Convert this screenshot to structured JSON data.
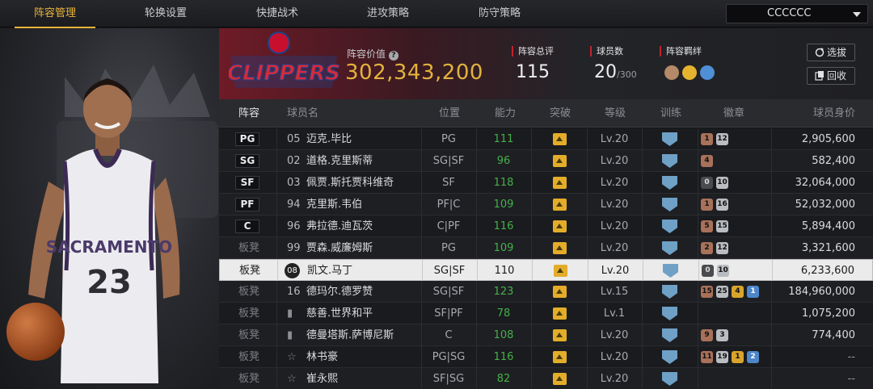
{
  "nav": {
    "tabs": [
      "阵容管理",
      "轮换设置",
      "快捷战术",
      "进攻策略",
      "防守策略"
    ],
    "team_select": "CCCCCC"
  },
  "header": {
    "team_logo_text": "CLIPPERS",
    "lineup_value_label": "阵容价值",
    "lineup_value": "302,343,200",
    "rating_label": "阵容总评",
    "rating_value": "115",
    "count_label": "球员数",
    "count_value": "20",
    "count_max": "/300",
    "chem_label": "阵容羁绊",
    "btn_draft": "选拔",
    "btn_recycle": "回收"
  },
  "table": {
    "headers": [
      "阵容",
      "球员名",
      "位置",
      "能力",
      "突破",
      "等级",
      "训练",
      "徽章",
      "球员身价"
    ],
    "rows": [
      {
        "slot": "PG",
        "starter": true,
        "num": "05",
        "name": "迈克.毕比",
        "pos": "PG",
        "ovr": "111",
        "level": "Lv.20",
        "badges": [
          [
            "b-br",
            "1"
          ],
          [
            "b-sv",
            "12"
          ]
        ],
        "value": "2,905,600"
      },
      {
        "slot": "SG",
        "starter": true,
        "num": "02",
        "name": "道格.克里斯蒂",
        "pos": "SG|SF",
        "ovr": "96",
        "level": "Lv.20",
        "badges": [
          [
            "b-br",
            "4"
          ]
        ],
        "value": "582,400"
      },
      {
        "slot": "SF",
        "starter": true,
        "num": "03",
        "name": "佩贾.斯托贾科维奇",
        "pos": "SF",
        "ovr": "118",
        "level": "Lv.20",
        "badges": [
          [
            "b-dk",
            "0"
          ],
          [
            "b-sv",
            "10"
          ]
        ],
        "value": "32,064,000"
      },
      {
        "slot": "PF",
        "starter": true,
        "num": "94",
        "name": "克里斯.韦伯",
        "pos": "PF|C",
        "ovr": "109",
        "level": "Lv.20",
        "badges": [
          [
            "b-br",
            "1"
          ],
          [
            "b-sv",
            "16"
          ]
        ],
        "value": "52,032,000"
      },
      {
        "slot": "C",
        "starter": true,
        "num": "96",
        "name": "弗拉德.迪瓦茨",
        "pos": "C|PF",
        "ovr": "116",
        "level": "Lv.20",
        "badges": [
          [
            "b-br",
            "5"
          ],
          [
            "b-sv",
            "15"
          ]
        ],
        "value": "5,894,400"
      },
      {
        "slot": "板凳",
        "starter": false,
        "num": "99",
        "name": "贾森.威廉姆斯",
        "pos": "PG",
        "ovr": "109",
        "level": "Lv.20",
        "badges": [
          [
            "b-br",
            "2"
          ],
          [
            "b-sv",
            "12"
          ]
        ],
        "value": "3,321,600"
      },
      {
        "slot": "板凳",
        "starter": false,
        "num": "08",
        "name": "凯文.马丁",
        "pos": "SG|SF",
        "ovr": "110",
        "level": "Lv.20",
        "badges": [
          [
            "b-dk",
            "0"
          ],
          [
            "b-sv",
            "10"
          ]
        ],
        "value": "6,233,600",
        "selected": true
      },
      {
        "slot": "板凳",
        "starter": false,
        "num": "16",
        "name": "德玛尔.德罗赞",
        "pos": "SG|SF",
        "ovr": "123",
        "level": "Lv.15",
        "badges": [
          [
            "b-br",
            "15"
          ],
          [
            "b-sv",
            "25"
          ],
          [
            "b-gd",
            "4"
          ],
          [
            "b-bl",
            "1"
          ]
        ],
        "value": "184,960,000"
      },
      {
        "slot": "板凳",
        "starter": false,
        "num": "",
        "name": "慈善.世界和平",
        "pos": "SF|PF",
        "ovr": "78",
        "level": "Lv.1",
        "badges": [],
        "value": "1,075,200"
      },
      {
        "slot": "板凳",
        "starter": false,
        "num": "",
        "name": "德曼塔斯.萨博尼斯",
        "pos": "C",
        "ovr": "108",
        "level": "Lv.20",
        "badges": [
          [
            "b-br",
            "9"
          ],
          [
            "b-sv",
            "3"
          ]
        ],
        "value": "774,400"
      },
      {
        "slot": "板凳",
        "starter": false,
        "num": "",
        "name": "林书豪",
        "pos": "PG|SG",
        "ovr": "116",
        "level": "Lv.20",
        "badges": [
          [
            "b-br",
            "11"
          ],
          [
            "b-sv",
            "19"
          ],
          [
            "b-gd",
            "1"
          ],
          [
            "b-bl",
            "2"
          ]
        ],
        "value": "--"
      },
      {
        "slot": "板凳",
        "starter": false,
        "num": "",
        "name": "崔永熙",
        "pos": "SF|SG",
        "ovr": "82",
        "level": "Lv.20",
        "badges": [],
        "value": "--"
      }
    ]
  },
  "player_art": {
    "team_text": "SACRAMENTO",
    "jersey_number": "23"
  }
}
